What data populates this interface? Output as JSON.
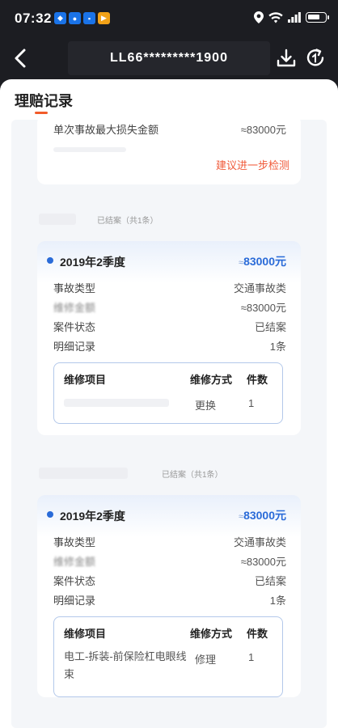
{
  "status_bar": {
    "time": "07:32",
    "notifications": [
      {
        "name": "app-notification-icon",
        "glyph": "◆",
        "color": "#1a73e8"
      },
      {
        "name": "app-notification-icon",
        "glyph": "●",
        "color": "#1a73e8"
      },
      {
        "name": "app-notification-icon",
        "glyph": "▪",
        "color": "#1a73e8"
      },
      {
        "name": "app-notification-icon",
        "glyph": "▶",
        "color": "#f2a218"
      }
    ],
    "icons": [
      "location-icon",
      "wifi-icon",
      "signal-icon",
      "battery-icon"
    ]
  },
  "nav": {
    "title": "LL66*********1900",
    "back_icon": "back-arrow-icon",
    "download_icon": "download-icon",
    "refresh_icon": "refresh-icon"
  },
  "sheet": {
    "title": "理赔记录",
    "accent_color": "#f25c2a"
  },
  "summary_card": {
    "label": "单次事故最大损失金额",
    "value": "≈83000元",
    "action": "建议进一步检测"
  },
  "records": [
    {
      "section_label": "已结案（共1条）",
      "period": "2019年2季度",
      "amount_prefix": "≈",
      "amount_value": "83000元",
      "rows": [
        {
          "label": "事故类型",
          "value": "交通事故类"
        },
        {
          "label": "维修金额",
          "value": "≈83000元"
        },
        {
          "label": "案件状态",
          "value": "已结案"
        },
        {
          "label": "明细记录",
          "value": "1条"
        }
      ],
      "table": {
        "headers": [
          "维修项目",
          "维修方式",
          "件数"
        ],
        "rows": [
          {
            "item": "",
            "method": "更换",
            "count": "1"
          }
        ]
      }
    },
    {
      "section_label": "已结案（共1条）",
      "period": "2019年2季度",
      "amount_prefix": "≈",
      "amount_value": "83000元",
      "rows": [
        {
          "label": "事故类型",
          "value": "交通事故类"
        },
        {
          "label": "维修金额",
          "value": "≈83000元"
        },
        {
          "label": "案件状态",
          "value": "已结案"
        },
        {
          "label": "明细记录",
          "value": "1条"
        }
      ],
      "table": {
        "headers": [
          "维修项目",
          "维修方式",
          "件数"
        ],
        "rows": [
          {
            "item": "电工-拆装-前保险杠电眼线束",
            "method": "修理",
            "count": "1"
          }
        ]
      }
    }
  ]
}
